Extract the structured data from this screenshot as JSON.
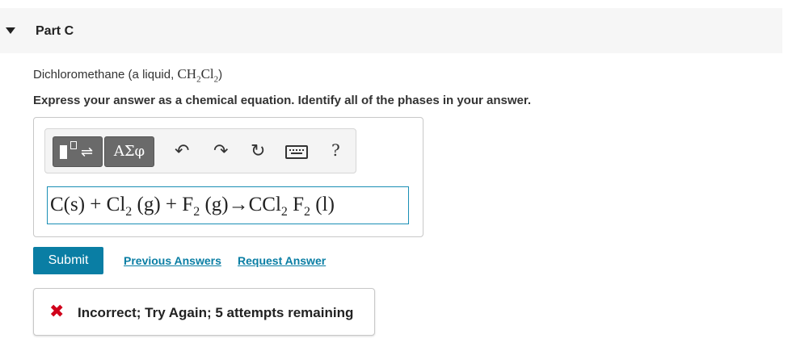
{
  "part": {
    "title": "Part C"
  },
  "question": {
    "prefix": "Dichloromethane (a liquid, ",
    "formula": {
      "a": "CH",
      "sub1": "2",
      "b": "Cl",
      "sub2": "2"
    },
    "suffix": ")",
    "instruction": "Express your answer as a chemical equation. Identify all of the phases in your answer."
  },
  "toolbar": {
    "templates_icon": "templates-icon",
    "greek_label": "ΑΣφ",
    "undo_glyph": "↶",
    "redo_glyph": "↷",
    "reset_glyph": "↻",
    "keyboard_icon": "keyboard-icon",
    "help_label": "?"
  },
  "answer": {
    "p1": "C(s) + Cl",
    "s1": "2",
    "p2": " (g) + F",
    "s2": "2",
    "p3": " (g)→CCl",
    "s3": "2",
    "p4": " F",
    "s4": "2",
    "p5": " (l)"
  },
  "actions": {
    "submit_label": "Submit",
    "previous_answers_label": "Previous Answers",
    "request_answer_label": "Request Answer"
  },
  "feedback": {
    "icon": "x-icon",
    "text": "Incorrect; Try Again; 5 attempts remaining",
    "color": "#d0021b"
  },
  "colors": {
    "accent": "#0a7ea4",
    "error": "#d0021b"
  }
}
